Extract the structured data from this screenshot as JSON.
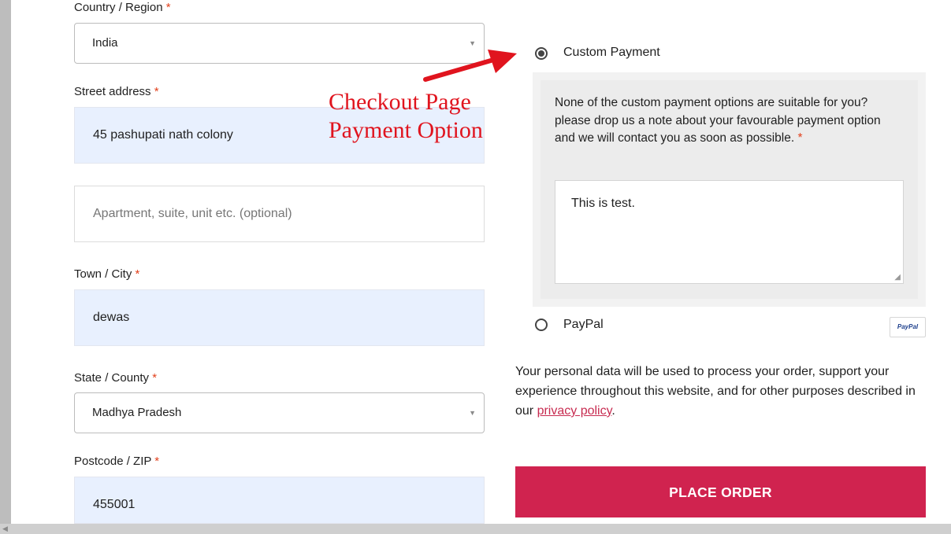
{
  "billing": {
    "country_label": "Country / Region",
    "country_value": "India",
    "street_label": "Street address",
    "street_value": "45 pashupati nath colony",
    "apartment_placeholder": "Apartment, suite, unit etc. (optional)",
    "city_label": "Town / City",
    "city_value": "dewas",
    "state_label": "State / County",
    "state_value": "Madhya Pradesh",
    "postcode_label": "Postcode / ZIP",
    "postcode_value": "455001",
    "required_marker": "*"
  },
  "annotation": {
    "line1": "Checkout Page",
    "line2": "Payment Option",
    "color": "#e0141e"
  },
  "payment": {
    "custom_label": "Custom Payment",
    "custom_selected": true,
    "custom_description": "None of the custom payment options are suitable for you? please drop us a note about your favourable payment option and we will contact you as soon as possible.",
    "note_value": "This is test.",
    "paypal_label": "PayPal",
    "paypal_logo_text": "PayPal",
    "paypal_selected": false
  },
  "privacy": {
    "text_before": "Your personal data will be used to process your order, support your experience throughout this website, and for other purposes described in our ",
    "link_text": "privacy policy",
    "text_after": "."
  },
  "place_order": {
    "label": "PLACE ORDER",
    "color": "#d0234f"
  },
  "icons": {
    "select_caret": "▼",
    "scroll_left": "◀",
    "resize_grip": "◢"
  }
}
